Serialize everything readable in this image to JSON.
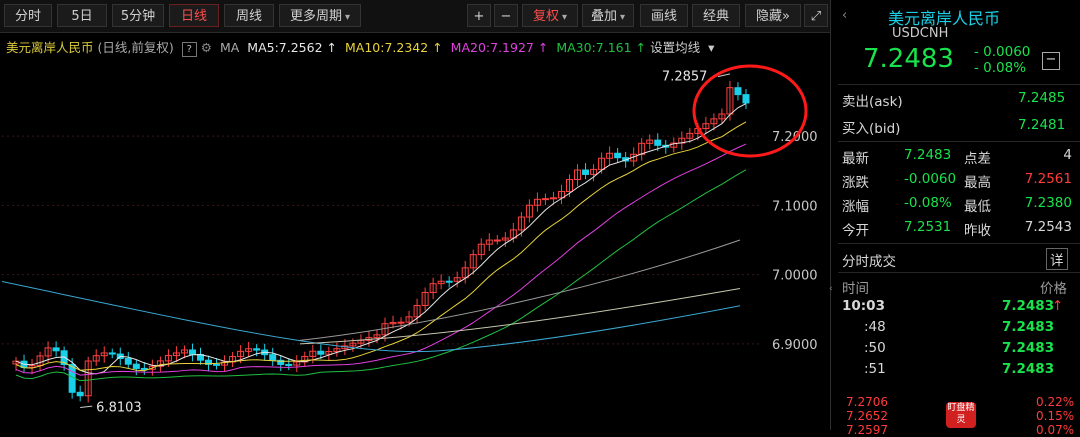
{
  "toolbar": {
    "periods": [
      "分时",
      "5日",
      "5分钟",
      "日线",
      "周线",
      "更多周期"
    ],
    "active_period": "日线",
    "plus": "+",
    "minus": "−",
    "adjust": "复权",
    "overlay": "叠加",
    "draw": "画线",
    "classic": "经典",
    "hide": "隐藏",
    "forward": "»",
    "fullscreen": "⤢"
  },
  "legend": {
    "name": "美元离岸人民币",
    "mode": "(日线,前复权)",
    "help": "?",
    "ma_label": "MA",
    "ma5": "MA5:7.2562",
    "ma10": "MA10:7.2342",
    "ma20": "MA20:7.1927",
    "ma30": "MA30:7.161",
    "settings": "设置均线",
    "colors": {
      "ma5": "#e6e6e6",
      "ma10": "#e8d33a",
      "ma20": "#e040e0",
      "ma30": "#20c040",
      "ma60": "#3aa6d0",
      "ma120": "#c8c8b0",
      "ma250": "#9a9a9a"
    }
  },
  "chart_data": {
    "type": "candlestick",
    "y_ticks": [
      "7.2000",
      "7.1000",
      "7.0000",
      "6.9000"
    ],
    "ylim": [
      6.79,
      7.31
    ],
    "high_label": "7.2857",
    "low_label": "6.8103",
    "colors": {
      "up": "#ff4040",
      "down": "#1ad0e8",
      "grid": "#3a1818"
    }
  },
  "panel": {
    "title": "美元离岸人民币",
    "code": "USDCNH",
    "price": "7.2483",
    "change": "- 0.0060",
    "change_pct": "- 0.08%",
    "ask_label": "卖出(ask)",
    "ask": "7.2485",
    "bid_label": "买入(bid)",
    "bid": "7.2481",
    "stats": [
      {
        "l1": "最新",
        "v1": "7.2483",
        "c1": "g",
        "l2": "点差",
        "v2": "4",
        "c2": "w"
      },
      {
        "l1": "涨跌",
        "v1": "-0.0060",
        "c1": "g",
        "l2": "最高",
        "v2": "7.2561",
        "c2": "r"
      },
      {
        "l1": "涨幅",
        "v1": "-0.08%",
        "c1": "g",
        "l2": "最低",
        "v2": "7.2380",
        "c2": "g"
      },
      {
        "l1": "今开",
        "v1": "7.2531",
        "c1": "g",
        "l2": "昨收",
        "v2": "7.2543",
        "c2": "w"
      }
    ],
    "ticks_title": "分时成交",
    "ticks_detail": "详",
    "ticks_col_time": "时间",
    "ticks_col_price": "价格",
    "ticks": [
      {
        "t": "10:03",
        "p": "7.2483"
      },
      {
        "t": ":48",
        "p": "7.2483"
      },
      {
        "t": ":50",
        "p": "7.2483"
      },
      {
        "t": ":51",
        "p": "7.2483"
      }
    ],
    "mini": [
      {
        "p": "7.2706",
        "pct": "0.22%"
      },
      {
        "p": "7.2652",
        "pct": "0.15%"
      },
      {
        "p": "7.2597",
        "pct": "0.07%"
      }
    ],
    "badge": "盯盘精灵"
  }
}
